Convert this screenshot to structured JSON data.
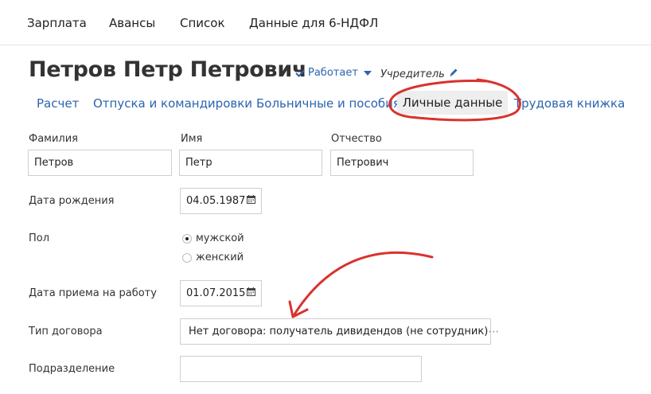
{
  "topnav": {
    "items": [
      "Зарплата",
      "Авансы",
      "Список",
      "Данные для 6-НДФЛ"
    ]
  },
  "employee": {
    "name": "Петров Петр Петрович",
    "status": "Работает",
    "role": "Учредитель"
  },
  "tabs": {
    "items": [
      "Расчет",
      "Отпуска и командировки",
      "Больничные и пособия",
      "Личные данные",
      "Трудовая книжка"
    ],
    "active": "Личные данные"
  },
  "form": {
    "last_name_label": "Фамилия",
    "last_name_value": "Петров",
    "first_name_label": "Имя",
    "first_name_value": "Петр",
    "patronymic_label": "Отчество",
    "patronymic_value": "Петрович",
    "birth_date_label": "Дата рождения",
    "birth_date_value": "04.05.1987",
    "gender_label": "Пол",
    "gender_options": [
      "мужской",
      "женский"
    ],
    "gender_selected": "мужской",
    "hire_date_label": "Дата приема на работу",
    "hire_date_value": "01.07.2015",
    "contract_label": "Тип договора",
    "contract_value": "Нет договора: получатель дивидендов (не сотрудник)",
    "department_label": "Подразделение",
    "department_value": ""
  },
  "colors": {
    "link": "#2b64b0",
    "annotation": "#d9322e"
  }
}
